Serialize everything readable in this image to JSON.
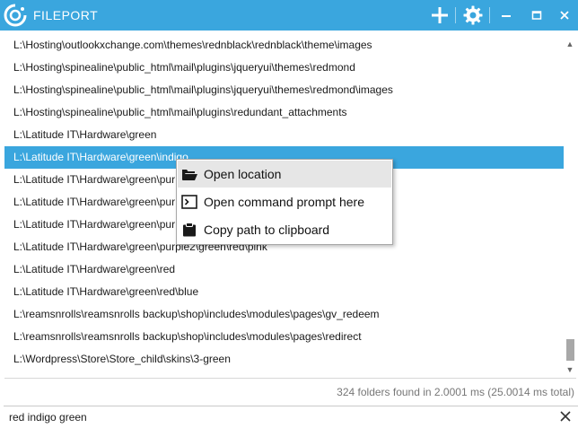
{
  "app": {
    "title": "FILEPORT"
  },
  "toolbar": {
    "add_icon": "plus-icon",
    "settings_icon": "gear-icon",
    "minimize_icon": "minimize-icon",
    "maximize_icon": "maximize-icon",
    "close_icon": "close-icon"
  },
  "results": [
    "L:\\Hosting\\outlookxchange.com\\themes\\rednblack\\rednblack\\theme\\images",
    "L:\\Hosting\\spinealine\\public_html\\mail\\plugins\\jqueryui\\themes\\redmond",
    "L:\\Hosting\\spinealine\\public_html\\mail\\plugins\\jqueryui\\themes\\redmond\\images",
    "L:\\Hosting\\spinealine\\public_html\\mail\\plugins\\redundant_attachments",
    "L:\\Latitude IT\\Hardware\\green",
    "L:\\Latitude IT\\Hardware\\green\\indigo",
    "L:\\Latitude IT\\Hardware\\green\\pur",
    "L:\\Latitude IT\\Hardware\\green\\pur",
    "L:\\Latitude IT\\Hardware\\green\\pur",
    "L:\\Latitude IT\\Hardware\\green\\purple2\\green\\red\\pink",
    "L:\\Latitude IT\\Hardware\\green\\red",
    "L:\\Latitude IT\\Hardware\\green\\red\\blue",
    "L:\\reamsnrolls\\reamsnrolls backup\\shop\\includes\\modules\\pages\\gv_redeem",
    "L:\\reamsnrolls\\reamsnrolls backup\\shop\\includes\\modules\\pages\\redirect",
    "L:\\Wordpress\\Store\\Store_child\\skins\\3-green"
  ],
  "selected_index": 5,
  "context_menu": {
    "items": [
      {
        "label": "Open location",
        "icon": "folder-open-icon"
      },
      {
        "label": "Open command prompt here",
        "icon": "terminal-icon"
      },
      {
        "label": "Copy path to clipboard",
        "icon": "clipboard-icon"
      }
    ]
  },
  "status": {
    "text": "324 folders found in 2.0001 ms (25.0014 ms total)"
  },
  "search": {
    "value": "red indigo green"
  },
  "colors": {
    "accent": "#3aa6de"
  }
}
